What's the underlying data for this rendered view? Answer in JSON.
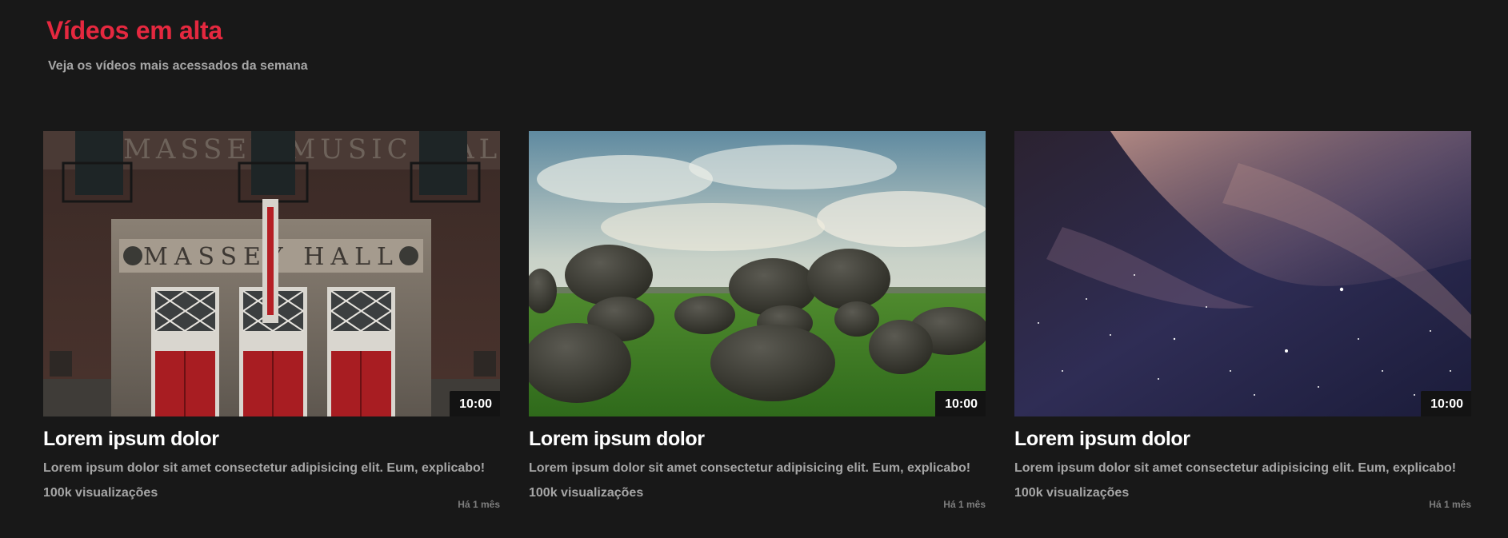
{
  "section": {
    "title": "Vídeos em alta",
    "subtitle": "Veja os vídeos mais acessados da semana"
  },
  "videos": [
    {
      "thumbnail": "massey-hall-building-photo",
      "thumbnail_sign": "MASSEY HALL",
      "thumbnail_upper_sign": "MASSEY MUSIC HALL",
      "duration": "10:00",
      "title": "Lorem ipsum dolor",
      "description": "Lorem ipsum dolor sit amet consectetur adipisicing elit. Eum, explicabo!",
      "views": "100k visualizações",
      "date": "Há 1 mês"
    },
    {
      "thumbnail": "boulders-on-grass-field-photo",
      "duration": "10:00",
      "title": "Lorem ipsum dolor",
      "description": "Lorem ipsum dolor sit amet consectetur adipisicing elit. Eum, explicabo!",
      "views": "100k visualizações",
      "date": "Há 1 mês"
    },
    {
      "thumbnail": "starry-night-sky-photo",
      "duration": "10:00",
      "title": "Lorem ipsum dolor",
      "description": "Lorem ipsum dolor sit amet consectetur adipisicing elit. Eum, explicabo!",
      "views": "100k visualizações",
      "date": "Há 1 mês"
    }
  ],
  "colors": {
    "background": "#181818",
    "accent": "#e5283f",
    "text_primary": "#ffffff",
    "text_secondary": "#a6a6a6",
    "text_muted": "#7e7e7e"
  }
}
